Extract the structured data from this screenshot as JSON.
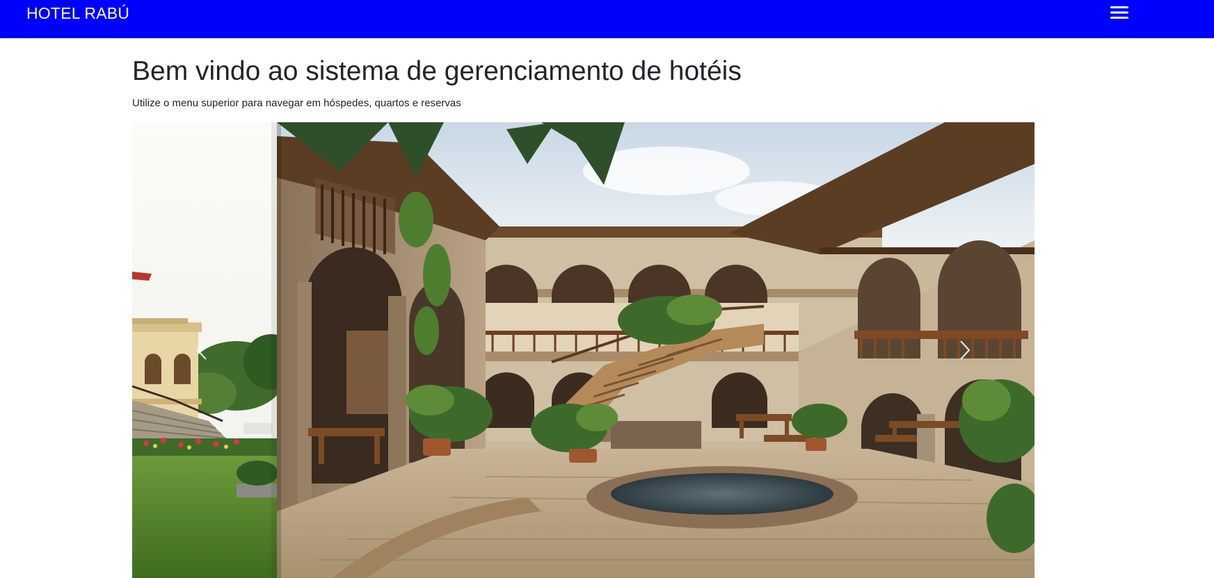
{
  "navbar": {
    "brand": "HOTEL RABÚ",
    "menu_icon": "hamburger-menu-icon",
    "background": "#0000ff"
  },
  "main": {
    "title": "Bem vindo ao sistema de gerenciamento de hotéis",
    "subtitle": "Utilize o menu superior para navegar em hóspedes, quartos e reservas"
  },
  "carousel": {
    "prev_icon": "chevron-left-icon",
    "next_icon": "chevron-right-icon",
    "active_slide_index": 1
  }
}
